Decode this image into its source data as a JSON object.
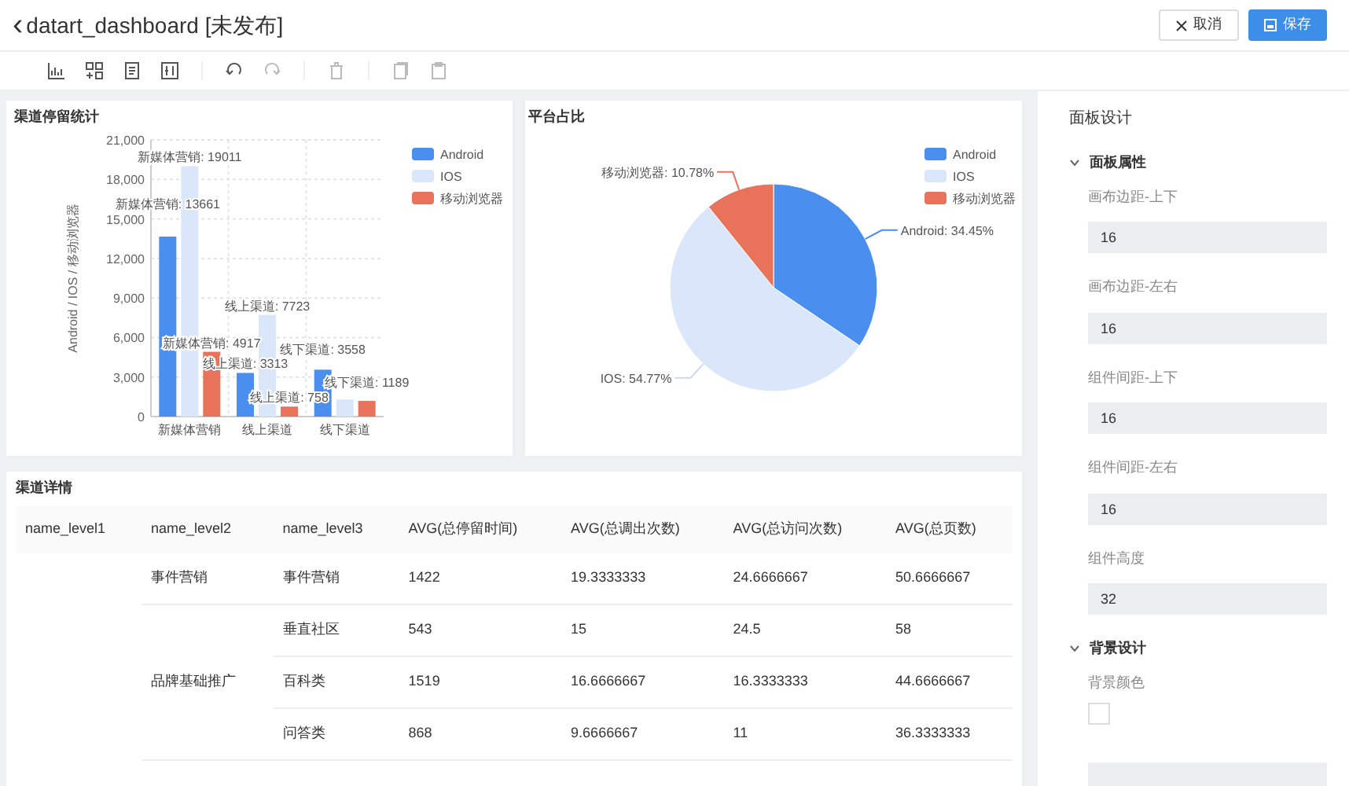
{
  "header": {
    "back_icon": "‹",
    "title": "datart_dashboard [未发布]",
    "buttons": [
      {
        "kind": "cancel",
        "label": "取消"
      },
      {
        "kind": "save",
        "label": "保存"
      }
    ]
  },
  "bar_panel": {
    "title": "渠道停留统计",
    "chart_data": {
      "type": "bar",
      "ylabel": "Android / IOS / 移动浏览器",
      "categories": [
        "新媒体营销",
        "线上渠道",
        "线下渠道"
      ],
      "series": [
        {
          "name": "Android",
          "color": "#4a8ef0",
          "values": [
            13661,
            3313,
            3558
          ],
          "value_labels": [
            "新媒体营销: 13661",
            "线上渠道: 3313",
            "线下渠道: 3558"
          ]
        },
        {
          "name": "IOS",
          "color": "#dae7fb",
          "values": [
            19011,
            7723,
            1300
          ],
          "value_labels": [
            "新媒体营销: 19011",
            "线上渠道: 7723",
            null
          ]
        },
        {
          "name": "移动浏览器",
          "color": "#e8735a",
          "values": [
            4917,
            758,
            1189
          ],
          "value_labels": [
            "新媒体营销: 4917",
            "线上渠道: 758",
            "线下渠道: 1189"
          ]
        }
      ],
      "ylim": [
        0,
        21000
      ],
      "yticks": [
        {
          "value": 0,
          "label": "0"
        },
        {
          "value": 3000,
          "label": "3,000"
        },
        {
          "value": 6000,
          "label": "6,000"
        },
        {
          "value": 9000,
          "label": "9,000"
        },
        {
          "value": 12000,
          "label": "12,000"
        },
        {
          "value": 15000,
          "label": "15,000"
        },
        {
          "value": 18000,
          "label": "18,000"
        },
        {
          "value": 21000,
          "label": "21,000"
        }
      ],
      "grid": true,
      "legend": true
    }
  },
  "pie_panel": {
    "title": "平台占比",
    "chart_data": {
      "type": "pie",
      "categories": [
        "Android",
        "IOS",
        "移动浏览器"
      ],
      "values": [
        34.45,
        54.77,
        10.78
      ],
      "colors": [
        "#4a8ef0",
        "#dae7fb",
        "#e8735a"
      ],
      "value_labels": [
        "Android: 34.45%",
        "IOS: 54.77%",
        "移动浏览器: 10.78%"
      ],
      "legend": true
    }
  },
  "table_panel": {
    "title": "渠道详情",
    "columns": [
      "name_level1",
      "name_level2",
      "name_level3",
      "AVG(总停留时间)",
      "AVG(总调出次数)",
      "AVG(总访问次数)",
      "AVG(总页数)"
    ],
    "groups": [
      {
        "name_level2": "事件营销",
        "rows": [
          [
            "事件营销",
            "1422",
            "19.3333333",
            "24.6666667",
            "50.6666667"
          ]
        ]
      },
      {
        "name_level2": "品牌基础推广",
        "rows": [
          [
            "垂直社区",
            "543",
            "15",
            "24.5",
            "58"
          ],
          [
            "百科类",
            "1519",
            "16.6666667",
            "16.3333333",
            "44.6666667"
          ],
          [
            "问答类",
            "868",
            "9.6666667",
            "11",
            "36.3333333"
          ]
        ]
      }
    ]
  },
  "sidebar": {
    "title": "面板设计",
    "sections": [
      {
        "title": "面板属性",
        "expanded": true,
        "fields": [
          {
            "kind": "input",
            "label": "画布边距-上下",
            "value": "16"
          },
          {
            "kind": "input",
            "label": "画布边距-左右",
            "value": "16"
          },
          {
            "kind": "input",
            "label": "组件间距-上下",
            "value": "16"
          },
          {
            "kind": "input",
            "label": "组件间距-左右",
            "value": "16"
          },
          {
            "kind": "input",
            "label": "组件高度",
            "value": "32"
          }
        ]
      },
      {
        "title": "背景设计",
        "expanded": true,
        "fields": [
          {
            "kind": "color",
            "label": "背景颜色",
            "color": "#ffffff"
          },
          {
            "kind": "blank"
          }
        ]
      }
    ]
  }
}
